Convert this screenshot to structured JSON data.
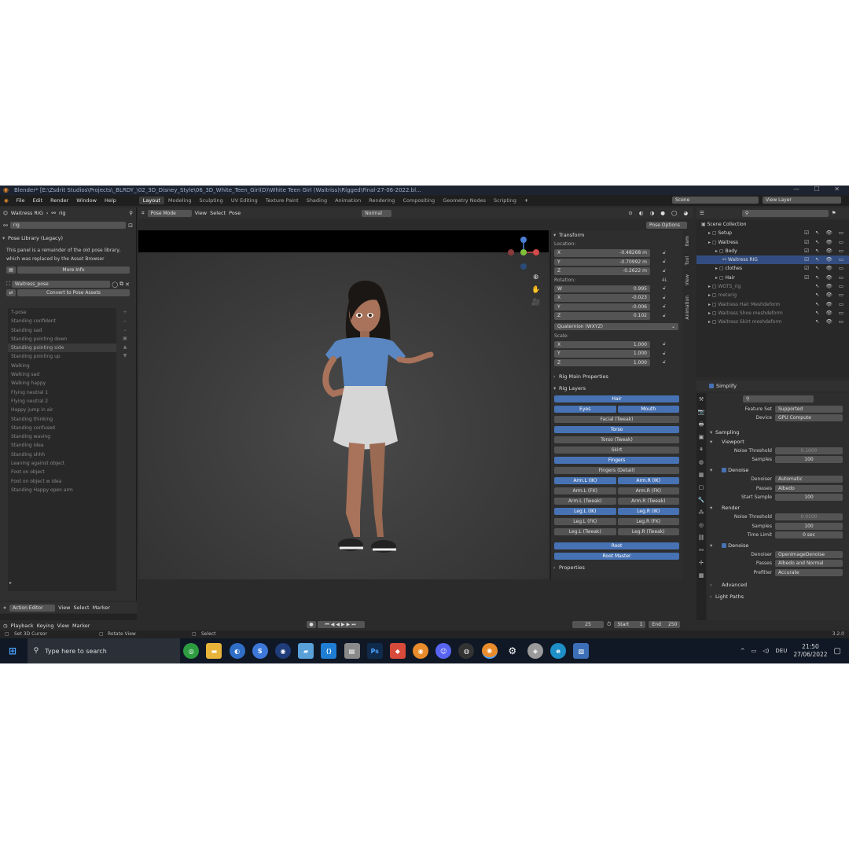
{
  "title": "Blender* [E:\\Zsdrit Studios\\Projects\\_BLRDY_\\02_3D_Disney_Style\\06_3D_White_Teen_Girl(D)\\White Teen Girl (Waitriss)\\Rigged\\Final-27-06-2022.bl...",
  "menu": [
    "File",
    "Edit",
    "Render",
    "Window",
    "Help"
  ],
  "workspaces": [
    "Layout",
    "Modeling",
    "Sculpting",
    "UV Editing",
    "Texture Paint",
    "Shading",
    "Animation",
    "Rendering",
    "Compositing",
    "Geometry Nodes",
    "Scripting"
  ],
  "active_workspace": "Layout",
  "scene": "Scene",
  "view_layer": "View Layer",
  "left": {
    "object": "Waitress RIG",
    "armature": "rig",
    "search": "rig",
    "pose_library_title": "Pose Library (Legacy)",
    "legacy_text1": "This panel is a remainder of the old pose library,",
    "legacy_text2": "which was replaced by the Asset Browser",
    "more_info": "More Info",
    "pose_lib_name": "Waitress_pose",
    "convert": "Convert to Pose Assets",
    "poses": [
      "T-pose",
      "Standing confident",
      "Standing sad",
      "Standing pointing down",
      "Standing pointing side",
      "Standing pointing up",
      "Walking",
      "Walking sad",
      "Walking happy",
      "Flying neutral 1",
      "Flying neutral 2",
      "Happy jump in air",
      "Standing thinking",
      "Standing confused",
      "Standing waving",
      "Standing idea",
      "Standing shhh",
      "Leaning against object",
      "Foot on object",
      "Foot on object w idea",
      "Standing Happy open arm"
    ],
    "action_editor": "Action Editor",
    "action_menu": [
      "View",
      "Select",
      "Marker"
    ]
  },
  "viewport": {
    "mode": "Pose Mode",
    "menu": [
      "View",
      "Select",
      "Pose"
    ],
    "orientation": "Normal",
    "pose_options": "Pose Options"
  },
  "npanel": {
    "tabs": [
      "Item",
      "Tool",
      "View",
      "Animation"
    ],
    "transform": "Transform",
    "location_label": "Location:",
    "location": [
      [
        "X",
        "-0.48268 m"
      ],
      [
        "Y",
        "-0.70992 m"
      ],
      [
        "Z",
        "-0.2622 m"
      ]
    ],
    "rotation_label": "Rotation:",
    "rotation_mode_short": "4L",
    "rotation": [
      [
        "W",
        "0.995"
      ],
      [
        "X",
        "-0.023"
      ],
      [
        "Y",
        "-0.006"
      ],
      [
        "Z",
        "0.102"
      ]
    ],
    "rotation_mode": "Quaternion (WXYZ)",
    "scale_label": "Scale:",
    "scale": [
      [
        "X",
        "1.000"
      ],
      [
        "Y",
        "1.000"
      ],
      [
        "Z",
        "1.000"
      ]
    ],
    "rig_main": "Rig Main Properties",
    "rig_layers": "Rig Layers",
    "layers": [
      [
        {
          "t": "Hair",
          "on": true
        }
      ],
      [
        {
          "t": "Eyes",
          "on": true
        },
        {
          "t": "Mouth",
          "on": true
        }
      ],
      [
        {
          "t": "Facial (Tweak)",
          "on": false
        }
      ],
      [
        {
          "t": "Torso",
          "on": true
        }
      ],
      [
        {
          "t": "Torso (Tweak)",
          "on": false
        }
      ],
      [
        {
          "t": "Skirt",
          "on": false
        }
      ],
      [
        {
          "t": "Fingers",
          "on": true
        }
      ],
      [
        {
          "t": "Fingers (Detail)",
          "on": false
        }
      ],
      [
        {
          "t": "Arm.L (IK)",
          "on": true
        },
        {
          "t": "Arm.R (IK)",
          "on": true
        }
      ],
      [
        {
          "t": "Arm.L (FK)",
          "on": false
        },
        {
          "t": "Arm.R (FK)",
          "on": false
        }
      ],
      [
        {
          "t": "Arm.L (Tweak)",
          "on": false
        },
        {
          "t": "Arm.R (Tweak)",
          "on": false
        }
      ],
      [
        {
          "t": "Leg.L (IK)",
          "on": true
        },
        {
          "t": "Leg.R (IK)",
          "on": true
        }
      ],
      [
        {
          "t": "Leg.L (FK)",
          "on": false
        },
        {
          "t": "Leg.R (FK)",
          "on": false
        }
      ],
      [
        {
          "t": "Leg.L (Tweak)",
          "on": false
        },
        {
          "t": "Leg.R (Tweak)",
          "on": false
        }
      ]
    ],
    "root": "Root",
    "root_master": "Root Master",
    "properties": "Properties"
  },
  "outliner": {
    "items": [
      {
        "name": "Scene Collection",
        "indent": 0,
        "dim": false,
        "sel": false
      },
      {
        "name": "Setup",
        "indent": 1,
        "dim": false,
        "sel": false
      },
      {
        "name": "Waitress",
        "indent": 1,
        "dim": false,
        "sel": false
      },
      {
        "name": "Body",
        "indent": 2,
        "dim": false,
        "sel": false
      },
      {
        "name": "Waitress RIG",
        "indent": 3,
        "dim": false,
        "sel": true
      },
      {
        "name": "clothes",
        "indent": 2,
        "dim": false,
        "sel": false
      },
      {
        "name": "Hair",
        "indent": 2,
        "dim": false,
        "sel": false
      },
      {
        "name": "WGTS_rig",
        "indent": 1,
        "dim": true,
        "sel": false
      },
      {
        "name": "metarig",
        "indent": 1,
        "dim": true,
        "sel": false
      },
      {
        "name": "Waitress Hair Meshdeform",
        "indent": 1,
        "dim": true,
        "sel": false
      },
      {
        "name": "Waitress Shoe meshdeform",
        "indent": 1,
        "dim": true,
        "sel": false
      },
      {
        "name": "Waitress Skirt meshdeform",
        "indent": 1,
        "dim": true,
        "sel": false
      }
    ]
  },
  "props": {
    "simplify": "Simplify",
    "feature_set_label": "Feature Set",
    "feature_set": "Supported",
    "device_label": "Device",
    "device": "GPU Compute",
    "sampling": "Sampling",
    "viewport": "Viewport",
    "noise_threshold_label": "Noise Threshold",
    "vp_noise": "0.1000",
    "samples_label": "Samples",
    "vp_samples": "100",
    "denoise": "Denoise",
    "denoiser_label": "Denoiser",
    "vp_denoiser": "Automatic",
    "passes_label": "Passes",
    "vp_passes": "Albedo",
    "start_sample_label": "Start Sample",
    "vp_start": "100",
    "render": "Render",
    "r_noise": "0.0100",
    "r_samples": "100",
    "time_limit_label": "Time Limit",
    "r_time": "0 sec",
    "r_denoiser": "OpenImageDenoise",
    "r_passes": "Albedo and Normal",
    "prefilter_label": "Prefilter",
    "r_prefilter": "Accurate",
    "advanced": "Advanced",
    "light_paths": "Light Paths"
  },
  "timeline": {
    "menu": [
      "Playback",
      "Keying",
      "View",
      "Marker"
    ],
    "frame": "25",
    "start_label": "Start",
    "start": "1",
    "end_label": "End",
    "end": "250"
  },
  "status": {
    "a": "Set 3D Cursor",
    "b": "Rotate View",
    "c": "Select",
    "version": "3.2.0"
  },
  "taskbar": {
    "search": "Type here to search",
    "lang": "DEU",
    "time": "21:50",
    "date": "27/06/2022"
  }
}
